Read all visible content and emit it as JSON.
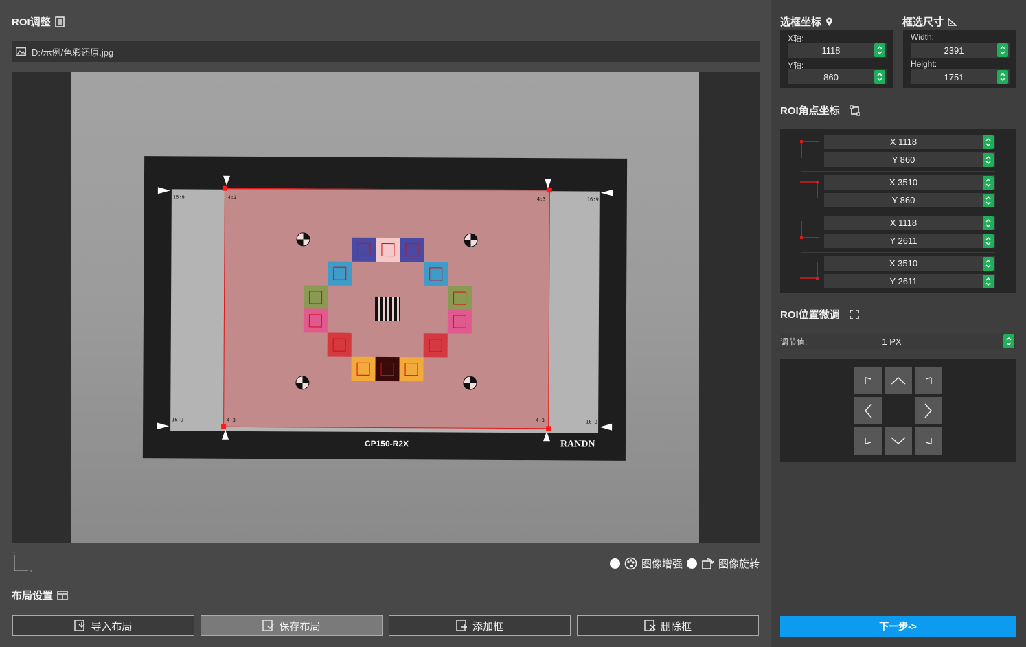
{
  "roi_section": {
    "title": "ROI调整",
    "title_icon": "list-icon"
  },
  "file": {
    "icon": "image-icon",
    "path": "D:/示例/色彩还原.jpg"
  },
  "chart_image": {
    "model_label": "CP150-R2X",
    "brand_label": "RANDN",
    "ratio_169": "16:9",
    "ratio_43": "4:3",
    "patch_colors": [
      "#4a4aa4",
      "#f4c9c9",
      "#4a4aa4",
      "#3f9bc8",
      "#3f9bc8",
      "#8a9a52",
      "#8a9a52",
      "#e15a8f",
      "#e15a8f",
      "#d5383f",
      "#d5383f",
      "#f2aa3a",
      "#3a0a0a",
      "#f2aa3a"
    ]
  },
  "options": {
    "enhance_label": "图像增强",
    "rotate_label": "图像旋转",
    "enhance_icon": "palette-icon",
    "rotate_icon": "rotate-icon"
  },
  "layout_section": {
    "title": "布局设置",
    "title_icon": "layout-icon"
  },
  "buttons": {
    "import": "导入布局",
    "save": "保存布局",
    "add": "添加框",
    "delete": "删除框"
  },
  "select_coord": {
    "title": "选框坐标",
    "icon": "location-pin-icon",
    "x_label": "X轴:",
    "x_value": "1118",
    "y_label": "Y轴:",
    "y_value": "860"
  },
  "select_size": {
    "title": "框选尺寸",
    "icon": "ruler-icon",
    "width_label": "Width:",
    "width_value": "2391",
    "height_label": "Height:",
    "height_value": "1751"
  },
  "corners": {
    "title": "ROI角点坐标",
    "icon": "crop-icon",
    "items": [
      {
        "x": "X 1118",
        "y": "Y 860"
      },
      {
        "x": "X 3510",
        "y": "Y 860"
      },
      {
        "x": "X 1118",
        "y": "Y 2611"
      },
      {
        "x": "X 3510",
        "y": "Y 2611"
      }
    ]
  },
  "finetune": {
    "title": "ROI位置微调",
    "icon": "expand-icon",
    "adjust_label": "调节值:",
    "adjust_value": "1 PX"
  },
  "accent": {
    "green": "#1fae59",
    "blue": "#0c9bef",
    "roi_red": "#e01a1a"
  },
  "next_label": "下一步->"
}
